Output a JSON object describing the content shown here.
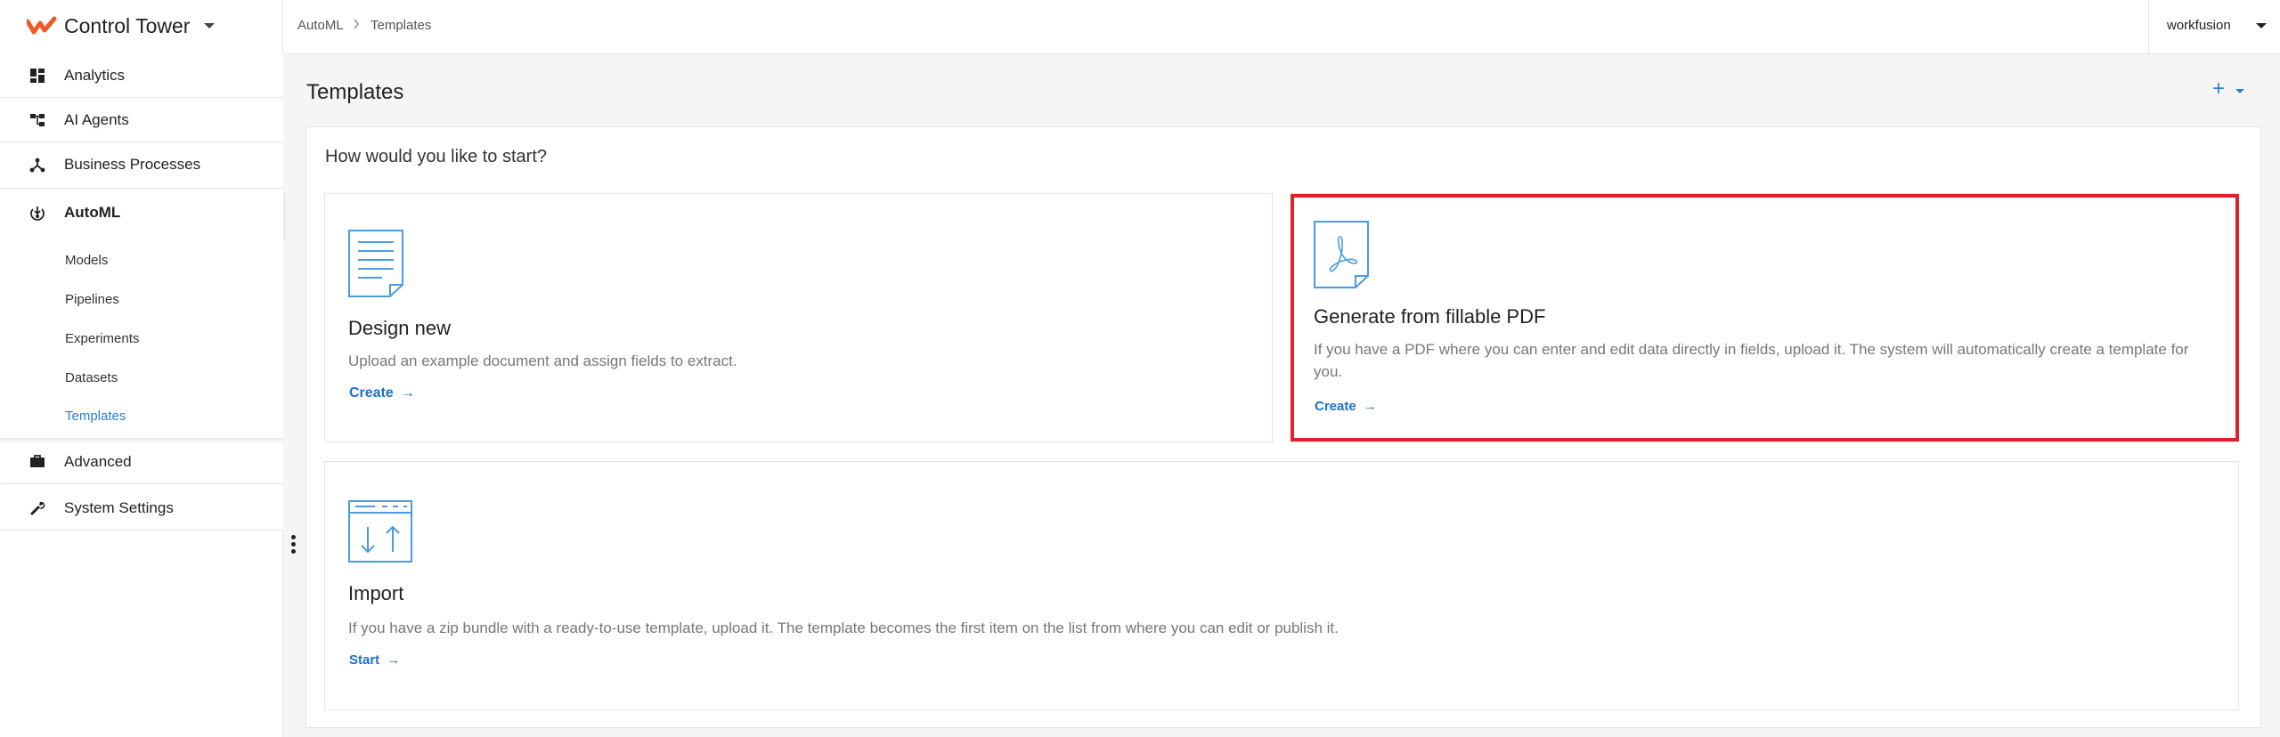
{
  "app": {
    "name": "Control Tower",
    "accent": "#2a7fd4",
    "logo_color": "#f05a28"
  },
  "sidebar": {
    "items": [
      {
        "label": "Analytics",
        "icon": "dashboard-icon"
      },
      {
        "label": "AI Agents",
        "icon": "hierarchy-icon"
      },
      {
        "label": "Business Processes",
        "icon": "process-icon"
      },
      {
        "label": "AutoML",
        "icon": "automl-icon"
      },
      {
        "label": "Advanced",
        "icon": "briefcase-icon"
      },
      {
        "label": "System Settings",
        "icon": "wrench-icon"
      }
    ],
    "automl_sub": [
      "Models",
      "Pipelines",
      "Experiments",
      "Datasets",
      "Templates"
    ]
  },
  "breadcrumb": [
    "AutoML",
    "Templates"
  ],
  "user": {
    "name": "workfusion"
  },
  "page": {
    "title": "Templates",
    "add_label": "+",
    "question": "How would you like to start?"
  },
  "cards": {
    "design": {
      "title": "Design new",
      "desc": "Upload an example document and assign fields to extract.",
      "link": "Create"
    },
    "pdf": {
      "title": "Generate from fillable PDF",
      "desc": "If you have a PDF where you can enter and edit data directly in fields, upload it. The system will automatically create a template for you.",
      "link": "Create"
    },
    "import": {
      "title": "Import",
      "desc": "If you have a zip bundle with a ready-to-use template, upload it. The template becomes the first item on the list from where you can edit or publish it.",
      "link": "Start"
    }
  }
}
